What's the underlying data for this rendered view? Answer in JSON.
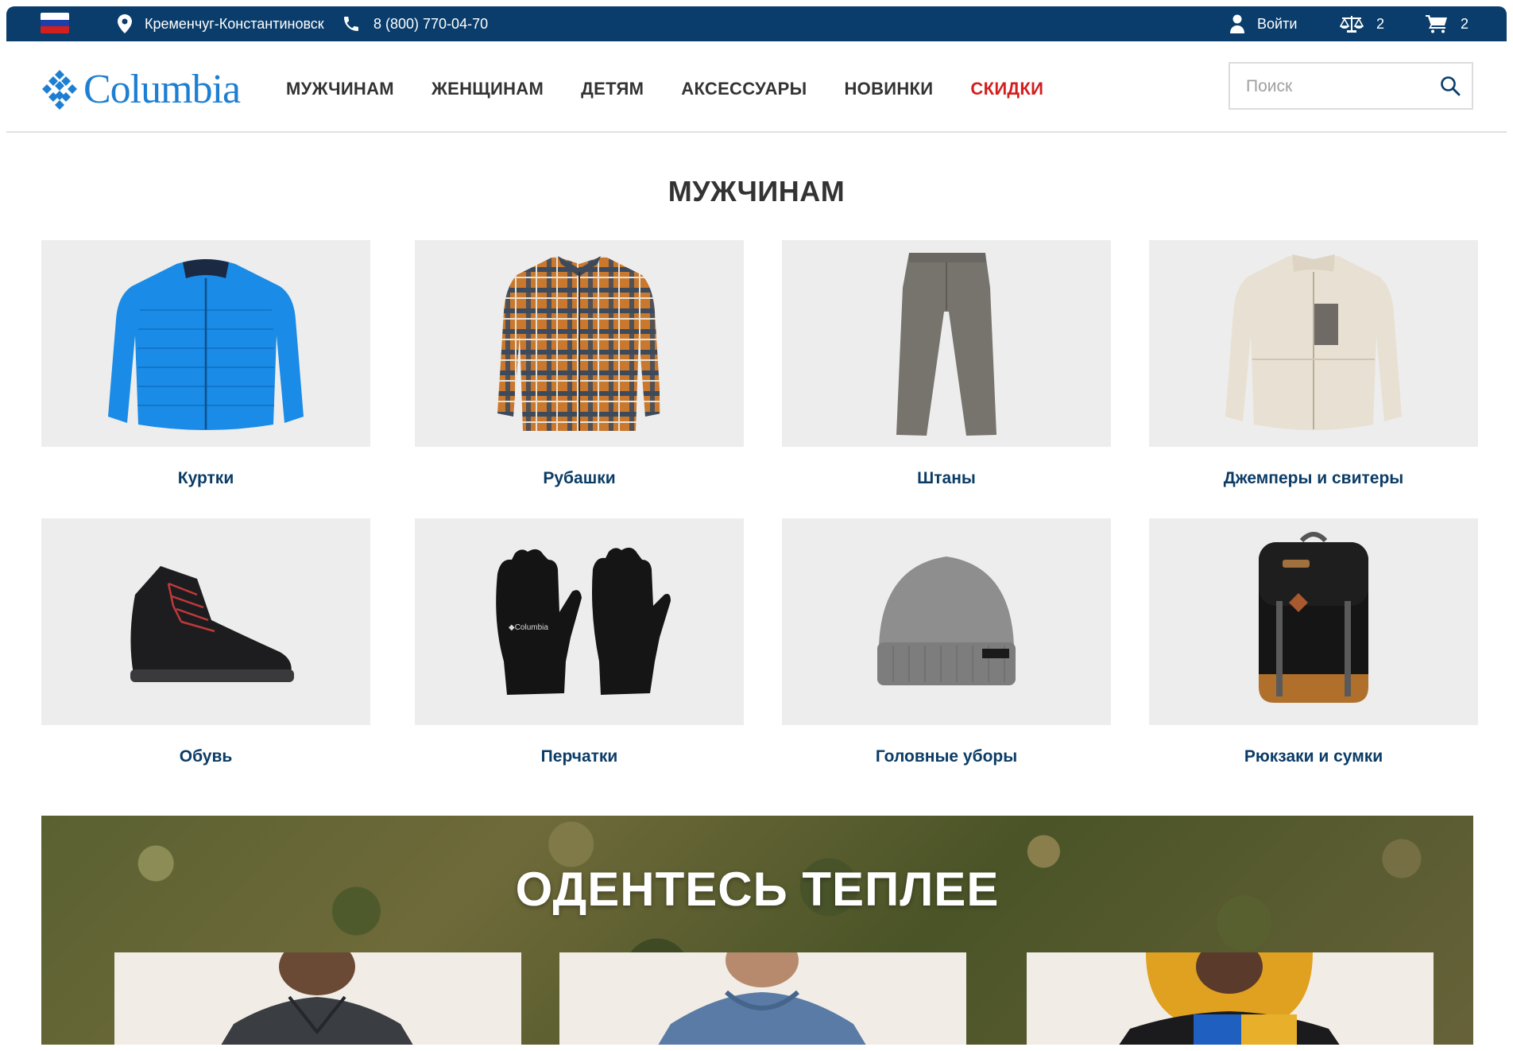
{
  "topbar": {
    "city": "Кременчуг-Константиновск",
    "phone": "8 (800) 770-04-70",
    "login_label": "Войти",
    "compare_count": "2",
    "cart_count": "2",
    "flag_colors": [
      "#ffffff",
      "#1c3fa8",
      "#d21f1f"
    ],
    "icons": [
      "map-pin-icon",
      "phone-icon",
      "user-icon",
      "compare-scales-icon",
      "cart-icon"
    ]
  },
  "header": {
    "logo_text": "Columbia",
    "nav": [
      {
        "label": "МУЖЧИНАМ"
      },
      {
        "label": "ЖЕНЩИНАМ"
      },
      {
        "label": "ДЕТЯМ"
      },
      {
        "label": "АКСЕССУАРЫ"
      },
      {
        "label": "НОВИНКИ"
      },
      {
        "label": "СКИДКИ"
      }
    ],
    "search_placeholder": "Поиск"
  },
  "section_title": "МУЖЧИНАМ",
  "categories": [
    {
      "label": "Куртки"
    },
    {
      "label": "Рубашки"
    },
    {
      "label": "Штаны"
    },
    {
      "label": "Джемперы и свитеры"
    },
    {
      "label": "Обувь"
    },
    {
      "label": "Перчатки"
    },
    {
      "label": "Головные уборы"
    },
    {
      "label": "Рюкзаки и сумки"
    }
  ],
  "promo": {
    "title": "ОДЕНТЕСЬ ТЕПЛЕЕ"
  },
  "colors": {
    "brand_navy": "#0a3d6b",
    "logo_blue": "#1e7fd2",
    "sale_red": "#d41e1e",
    "category_label": "#0b3c66"
  }
}
